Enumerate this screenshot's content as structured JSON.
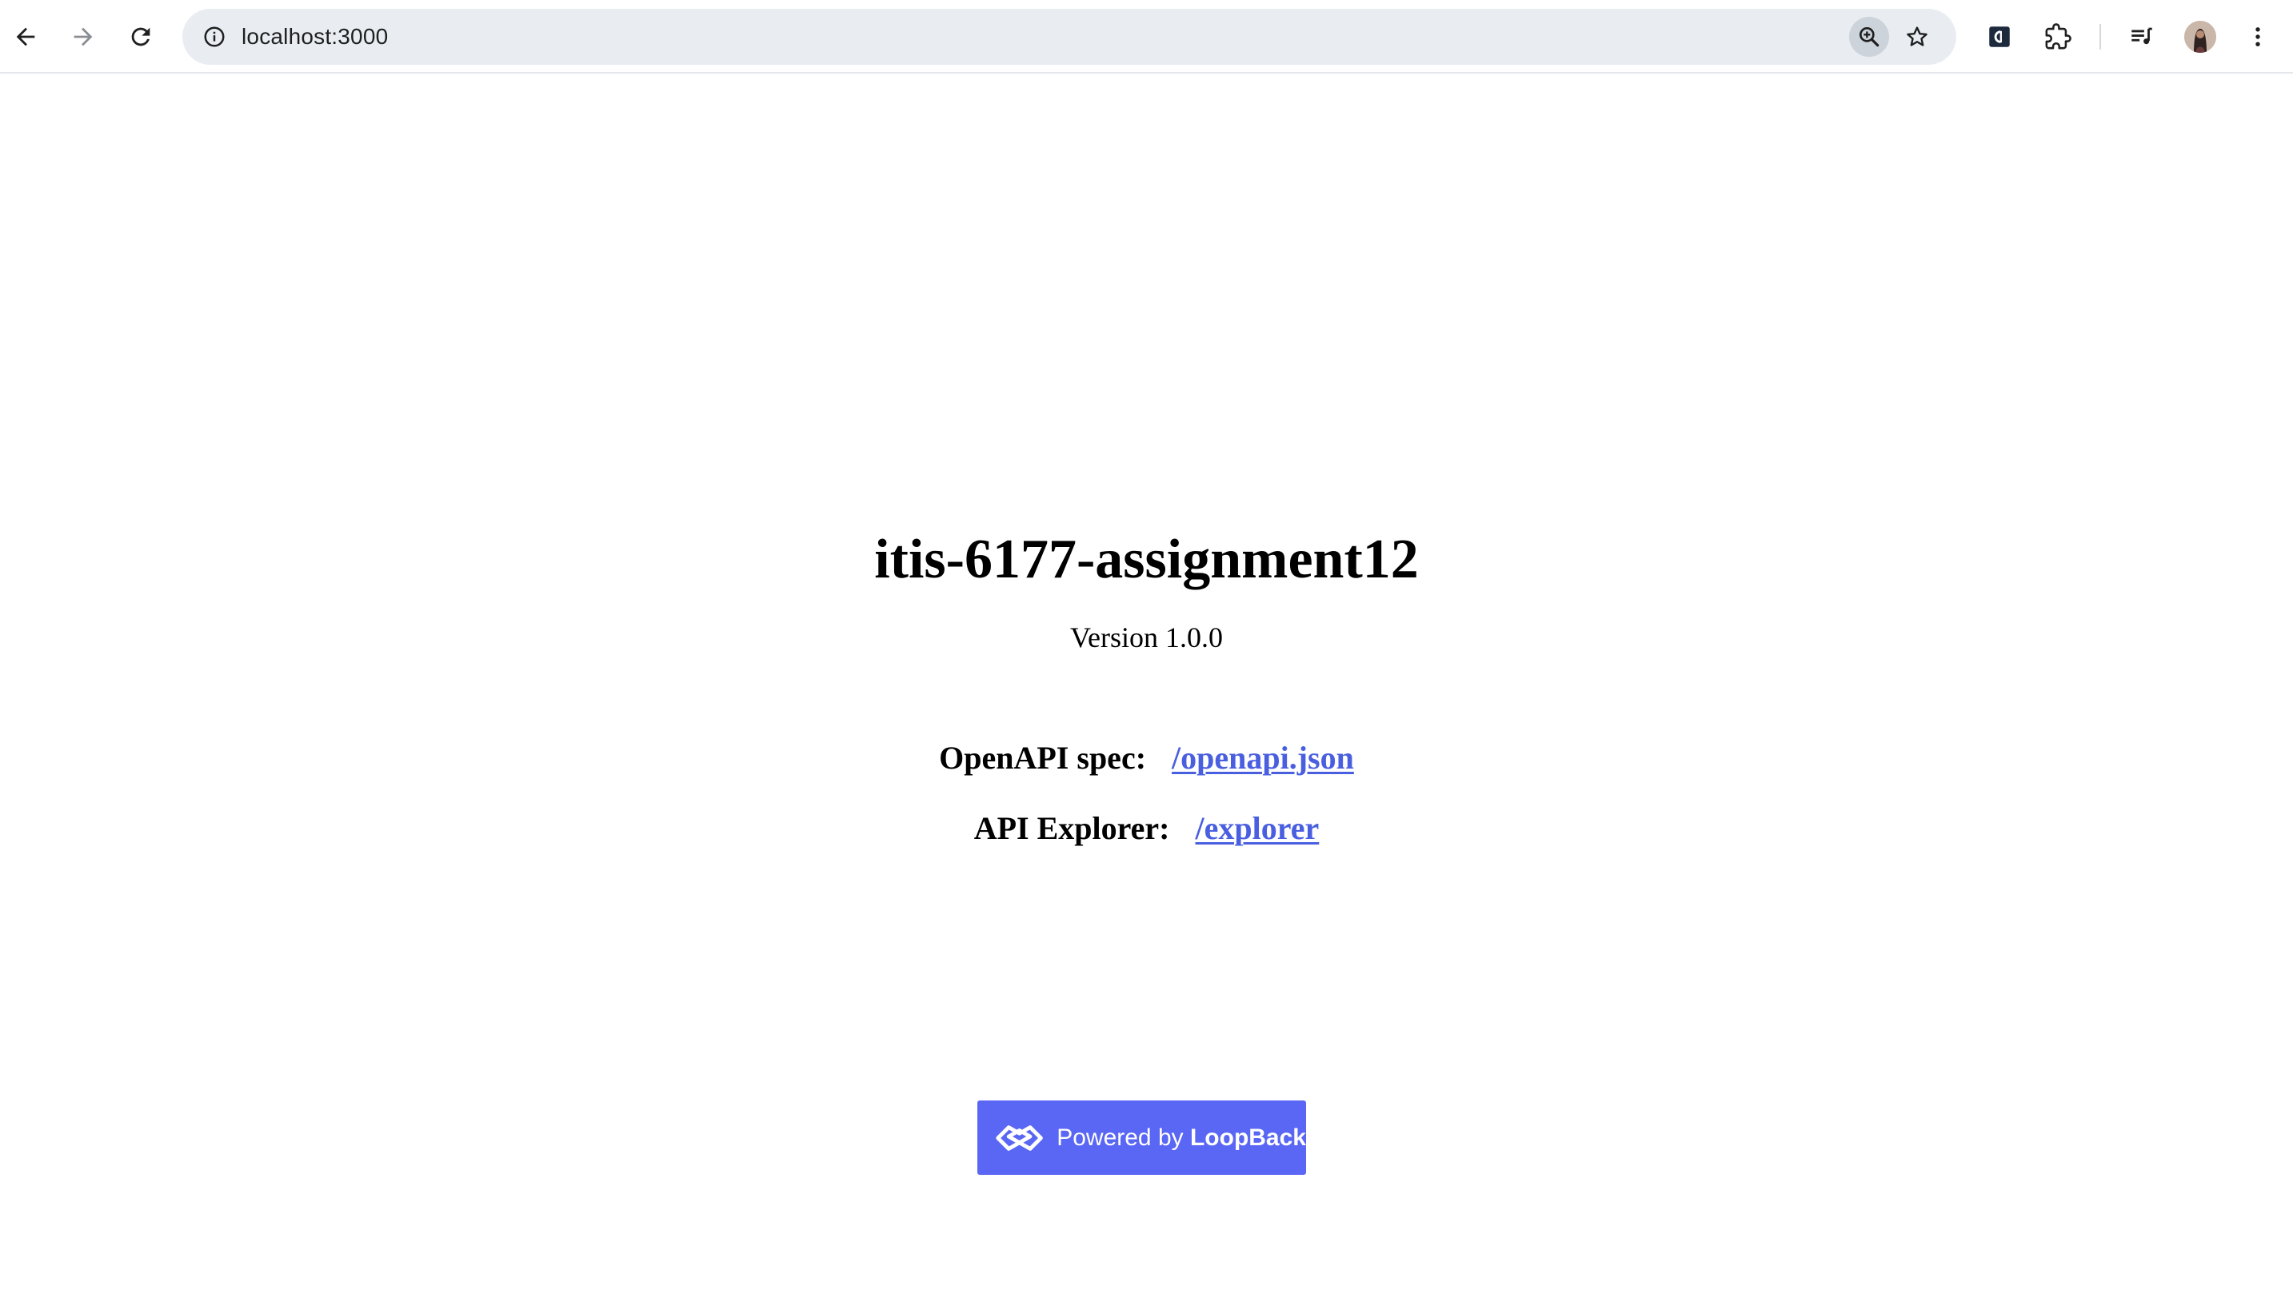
{
  "browser": {
    "url": "localhost:3000",
    "accent_color": "#e9edf2",
    "icons": {
      "back": "arrow-left-icon",
      "forward": "arrow-right-icon",
      "reload": "reload-icon",
      "site_info": "info-icon",
      "zoom": "zoom-icon",
      "bookmark": "star-icon",
      "extension_app": "app-extension-icon",
      "extensions": "puzzle-icon",
      "media": "media-queue-icon",
      "profile": "avatar",
      "menu": "kebab-menu-icon"
    }
  },
  "page": {
    "title": "itis-6177-assignment12",
    "version": "Version 1.0.0",
    "openapi_label": "OpenAPI spec:",
    "openapi_link": "/openapi.json",
    "explorer_label": "API Explorer:",
    "explorer_link": "/explorer",
    "link_color": "#4a5fe0"
  },
  "footer": {
    "powered_prefix": "Powered by ",
    "powered_brand": "LoopBack",
    "button_color": "#5a66f4"
  }
}
